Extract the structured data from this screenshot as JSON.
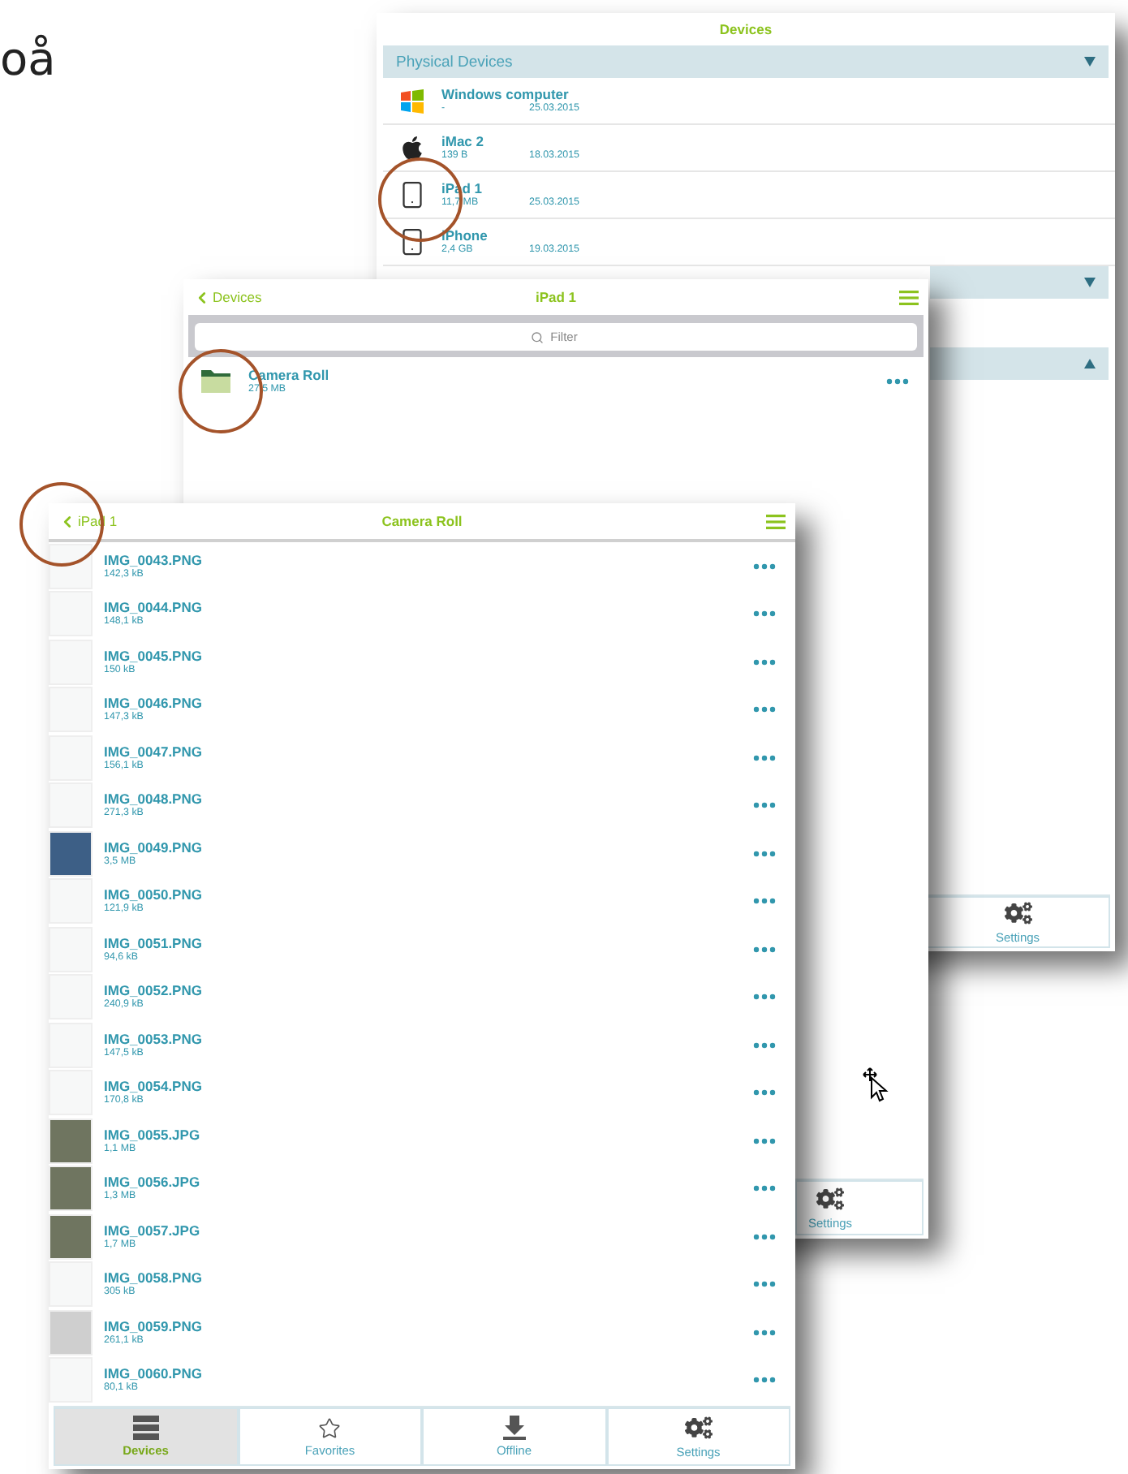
{
  "page_text": "oå",
  "devices_window": {
    "title": "Devices",
    "sections": [
      {
        "title": "Physical Devices",
        "expanded": true,
        "items": [
          {
            "kind": "windows",
            "name": "Windows computer",
            "size": "-",
            "date": "25.03.2015"
          },
          {
            "kind": "apple",
            "name": "iMac 2",
            "size": "139 B",
            "date": "18.03.2015"
          },
          {
            "kind": "phone",
            "name": "iPad 1",
            "size": "11,7 MB",
            "date": "25.03.2015"
          },
          {
            "kind": "phone",
            "name": "iPhone",
            "size": "2,4 GB",
            "date": "19.03.2015"
          }
        ]
      },
      {
        "expanded": true
      },
      {
        "expanded": false
      }
    ],
    "tabs": [
      {
        "kind": "settings",
        "label": "Settings",
        "selected": false
      }
    ]
  },
  "ipad_window": {
    "back": "Devices",
    "title": "iPad 1",
    "filter": {
      "placeholder": "Filter"
    },
    "items": [
      {
        "name": "Camera Roll",
        "size": "27,5 MB"
      }
    ],
    "tabs": [
      {
        "kind": "settings",
        "label": "Settings",
        "selected": false
      }
    ]
  },
  "camera_roll_window": {
    "back": "iPad 1",
    "title": "Camera Roll",
    "files": [
      {
        "name": "IMG_0043.PNG",
        "size": "142,3 kB",
        "kind": "screenshot"
      },
      {
        "name": "IMG_0044.PNG",
        "size": "148,1 kB",
        "kind": "screenshot"
      },
      {
        "name": "IMG_0045.PNG",
        "size": "150 kB",
        "kind": "screenshot"
      },
      {
        "name": "IMG_0046.PNG",
        "size": "147,3 kB",
        "kind": "screenshot"
      },
      {
        "name": "IMG_0047.PNG",
        "size": "156,1 kB",
        "kind": "screenshot"
      },
      {
        "name": "IMG_0048.PNG",
        "size": "271,3 kB",
        "kind": "screenshot"
      },
      {
        "name": "IMG_0049.PNG",
        "size": "3,5 MB",
        "kind": "homescreen"
      },
      {
        "name": "IMG_0050.PNG",
        "size": "121,9 kB",
        "kind": "screenshot"
      },
      {
        "name": "IMG_0051.PNG",
        "size": "94,6 kB",
        "kind": "screenshot"
      },
      {
        "name": "IMG_0052.PNG",
        "size": "240,9 kB",
        "kind": "screenshot"
      },
      {
        "name": "IMG_0053.PNG",
        "size": "147,5 kB",
        "kind": "screenshot"
      },
      {
        "name": "IMG_0054.PNG",
        "size": "170,8 kB",
        "kind": "screenshot"
      },
      {
        "name": "IMG_0055.JPG",
        "size": "1,1 MB",
        "kind": "photo"
      },
      {
        "name": "IMG_0056.JPG",
        "size": "1,3 MB",
        "kind": "photo"
      },
      {
        "name": "IMG_0057.JPG",
        "size": "1,7 MB",
        "kind": "photo"
      },
      {
        "name": "IMG_0058.PNG",
        "size": "305 kB",
        "kind": "screenshot"
      },
      {
        "name": "IMG_0059.PNG",
        "size": "261,1 kB",
        "kind": "grey"
      },
      {
        "name": "IMG_0060.PNG",
        "size": "80,1 kB",
        "kind": "screenshot"
      }
    ],
    "tabs": [
      {
        "kind": "devices",
        "label": "Devices",
        "selected": true
      },
      {
        "kind": "favorites",
        "label": "Favorites",
        "selected": false
      },
      {
        "kind": "offline",
        "label": "Offline",
        "selected": false
      },
      {
        "kind": "settings",
        "label": "Settings",
        "selected": false
      }
    ]
  }
}
